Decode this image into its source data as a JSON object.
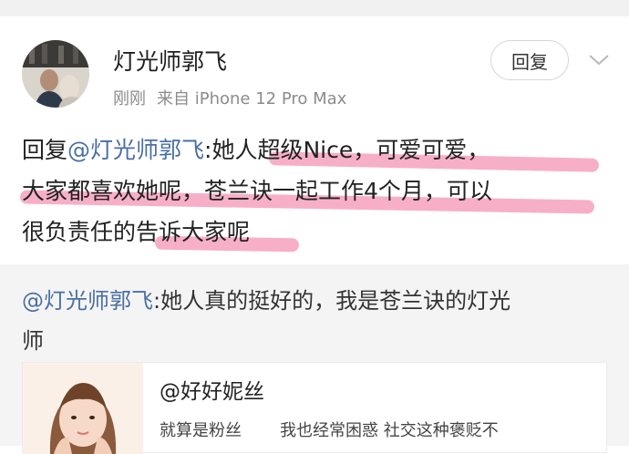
{
  "comment": {
    "username": "灯光师郭飞",
    "time": "刚刚",
    "source": "来自 iPhone 12 Pro Max",
    "reply_button": "回复",
    "chevron_icon": "chevron-down-icon",
    "lines": [
      {
        "prefix": "回复",
        "mention": "@灯光师郭飞",
        "text": ":她人超级Nice，可爱可爱，"
      },
      {
        "text": "大家都喜欢她呢，苍兰诀一起工作4个月，可以"
      },
      {
        "text": "很负责任的告诉大家呢"
      }
    ],
    "highlight_color": "#ec407a"
  },
  "quoted": {
    "mention": "@灯光师郭飞",
    "line1": ":她人真的挺好的，我是苍兰诀的灯光",
    "line2": "师"
  },
  "card": {
    "title": "@好好妮丝",
    "desc_part1": "就算是粉丝",
    "desc_part2": "我也经常困惑 社交这种褒贬不"
  },
  "colors": {
    "mention": "#4a6fa5",
    "meta": "#8b8b8b",
    "quote_bg": "#f4f4f4"
  }
}
